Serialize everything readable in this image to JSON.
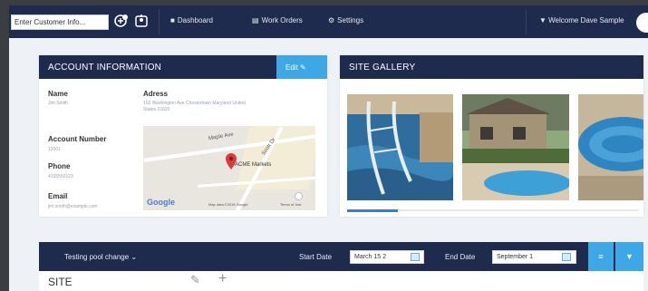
{
  "topnav": {
    "customer_input_value": "Enter Customer Info...",
    "links": [
      {
        "icon": "dashboard-icon",
        "glyph": "■",
        "label": "Dashboard"
      },
      {
        "icon": "work-orders-icon",
        "glyph": "▤",
        "label": "Work Orders"
      },
      {
        "icon": "settings-icon",
        "glyph": "⚙",
        "label": "Settings"
      }
    ],
    "welcome": "Welcome Dave Sample"
  },
  "account": {
    "header": "ACCOUNT INFORMATION",
    "edit_label": "Edit",
    "name_label": "Name",
    "name_value": "Jim Smith",
    "address_label": "Adress",
    "address_value_line1": "102 Washington Ave Chestertown Maryland United",
    "address_value_line2": "States 21620",
    "account_number_label": "Account Number",
    "account_number_value": "12001",
    "phone_label": "Phone",
    "phone_value": "4105550123",
    "email_label": "Email",
    "email_value": "jim.smith@example.com",
    "map": {
      "place_label": "ACME Markets",
      "road_1": "Maple Ave",
      "road_2": "Scott Dr",
      "google": "Google",
      "map_data": "Map data ©2016 Google",
      "terms": "Terms of Use"
    }
  },
  "gallery": {
    "header": "SITE GALLERY"
  },
  "filters": {
    "site_select": "Testing pool change",
    "start_label": "Start Date",
    "start_value": "March 15 2",
    "end_label": "End Date",
    "end_value": "September 1"
  },
  "site": {
    "title": "SITE"
  },
  "colors": {
    "navy": "#1f2b4d",
    "accent": "#3ea7e6",
    "page_bg": "#eef1f5"
  }
}
